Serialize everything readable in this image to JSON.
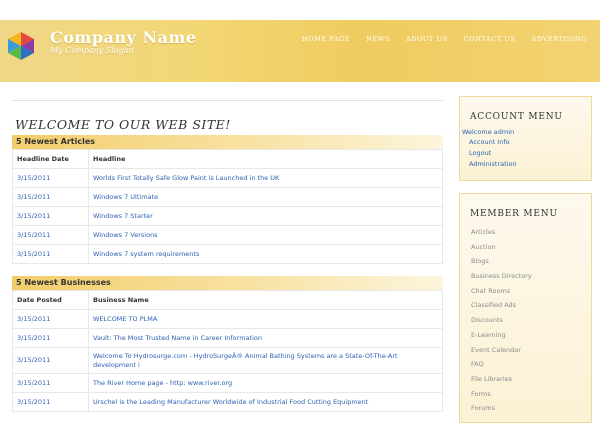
{
  "header": {
    "company_name": "Company Name",
    "slogan": "My Company Slogan",
    "nav": [
      "HOME PAGE",
      "NEWS",
      "ABOUT US",
      "CONTACT US",
      "ADVERTISING"
    ]
  },
  "main": {
    "welcome": "WELCOME TO OUR WEB SITE!",
    "articles": {
      "title": "5 Newest Articles",
      "columns": [
        "Headline Date",
        "Headline"
      ],
      "rows": [
        {
          "date": "3/15/2011",
          "headline": "Worlds First Totally Safe Glow Paint is Launched in the UK"
        },
        {
          "date": "3/15/2011",
          "headline": "Windows 7 Ultimate"
        },
        {
          "date": "3/15/2011",
          "headline": "Windows 7 Starter"
        },
        {
          "date": "3/15/2011",
          "headline": "Windows 7 Versions"
        },
        {
          "date": "3/15/2011",
          "headline": "Windows 7 system requirements"
        }
      ]
    },
    "businesses": {
      "title": "5 Newest Businesses",
      "columns": [
        "Date Posted",
        "Business Name"
      ],
      "rows": [
        {
          "date": "3/15/2011",
          "name": "WELCOME TO PLMA"
        },
        {
          "date": "3/15/2011",
          "name": "Vault: The Most Trusted Name in Career Information"
        },
        {
          "date": "3/15/2011",
          "name": "Welcome To Hydrosurge.com - HydroSurgeÂ® Animal Bathing Systems are a State-Of-The-Art development i"
        },
        {
          "date": "3/15/2011",
          "name": "The River Home page - http: www.river.org"
        },
        {
          "date": "3/15/2011",
          "name": "Urschel is the Leading Manufacturer Worldwide of Industrial Food Cutting Equipment"
        }
      ]
    }
  },
  "sidebar": {
    "account": {
      "title": "ACCOUNT MENU",
      "welcome": "Welcome admin",
      "links": [
        "Account Info",
        "Logout",
        "Administration"
      ]
    },
    "member": {
      "title": "MEMBER MENU",
      "items": [
        "Articles",
        "Auction",
        "Blogs",
        "Business Directory",
        "Chat Rooms",
        "Classified Ads",
        "Discounts",
        "E-Learning",
        "Event Calendar",
        "FAQ",
        "File Libraries",
        "Forms",
        "Forums"
      ]
    }
  },
  "colors": {
    "header_gold": "#f3d776",
    "link_blue": "#2e62b4",
    "section_head": "#f3cd6a"
  }
}
